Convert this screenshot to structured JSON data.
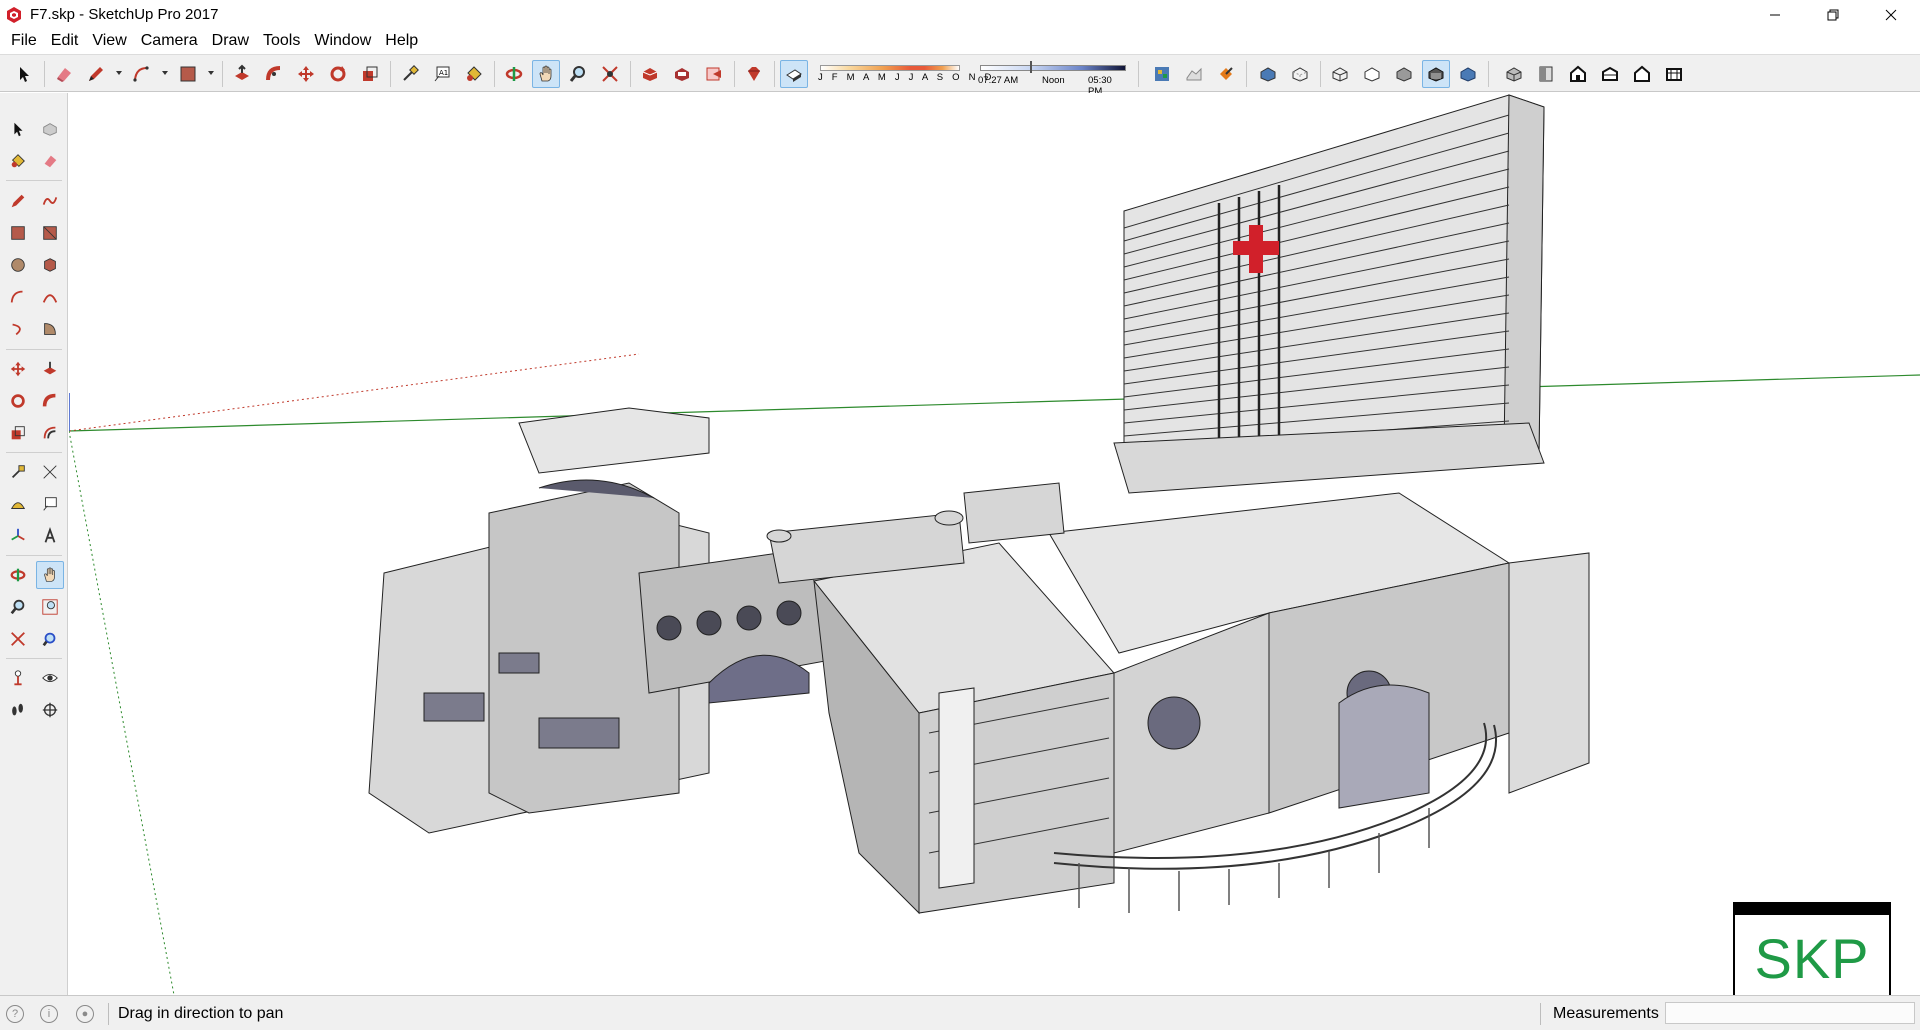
{
  "window": {
    "title": "F7.skp - SketchUp Pro 2017",
    "app_icon": "sketchup-logo-icon",
    "controls": [
      "minimize-icon",
      "restore-icon",
      "close-icon"
    ]
  },
  "menu": {
    "items": [
      "File",
      "Edit",
      "View",
      "Camera",
      "Draw",
      "Tools",
      "Window",
      "Help"
    ]
  },
  "toolbar": {
    "tools": [
      "select-icon",
      "eraser-icon",
      "pencil-icon",
      "arc-icon",
      "rectangle-icon",
      "push-pull-icon",
      "follow-me-icon",
      "move-icon",
      "rotate-icon",
      "scale-icon",
      "tape-measure-icon",
      "text-icon",
      "paint-bucket-icon",
      "orbit-icon",
      "pan-icon",
      "zoom-icon",
      "zoom-extents-icon",
      "3d-warehouse-icon",
      "extension-warehouse-icon",
      "layout-icon",
      "ruby-icon",
      "shadows-toggle-icon",
      "component-icon",
      "sandbox-icon",
      "section-icon",
      "xray-icon",
      "back-edges-icon",
      "wireframe-icon",
      "hidden-line-icon",
      "shaded-icon",
      "shaded-textures-icon",
      "monochrome-icon",
      "iso-view-icon",
      "top-view-icon",
      "front-view-icon",
      "right-view-icon",
      "back-view-icon",
      "left-view-icon"
    ],
    "active_tool": "pan-icon",
    "shadow_months": "J F M A M J J A S O N D",
    "shadow_time_start": "07:27 AM",
    "shadow_time_mid": "Noon",
    "shadow_time_end": "05:30 PM"
  },
  "left_tools": {
    "active_tool": "pan-icon"
  },
  "statusbar": {
    "icons": [
      "geo-location-icon",
      "credits-icon",
      "user-icon"
    ],
    "message": "Drag in direction to pan",
    "measurements_label": "Measurements",
    "measurements_value": ""
  },
  "watermark": {
    "text": "SKP"
  },
  "colors": {
    "accent_red": "#d1202a",
    "axis_green": "#2d8a2d",
    "axis_red": "#c0392b",
    "skp_green": "#1f9a46",
    "active_tool_bg": "#cde4f7"
  }
}
